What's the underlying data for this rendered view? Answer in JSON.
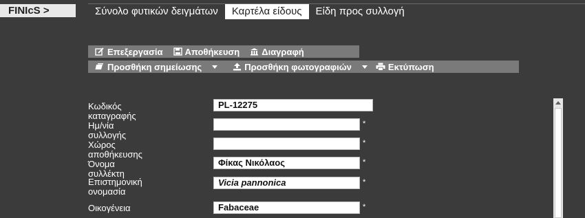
{
  "app": {
    "logo": "FINIcS >"
  },
  "tabs": [
    {
      "label": "Σύνολο φυτικών δειγμάτων",
      "active": false
    },
    {
      "label": "Καρτέλα είδους",
      "active": true
    },
    {
      "label": "Είδη προς συλλογή",
      "active": false
    }
  ],
  "toolbar1": {
    "edit": "Επεξεργασία",
    "save": "Αποθήκευση",
    "delete": "Διαγραφή"
  },
  "toolbar2": {
    "add_note": "Προσθήκη σημείωσης",
    "add_photos": "Προσθήκη φωτογραφιών",
    "print": "Εκτύπωση"
  },
  "form": {
    "fields": [
      {
        "label": "Κωδικός καταγραφής",
        "value": "PL-12275",
        "required": false
      },
      {
        "label": "Ημ/νία συλλογής",
        "value": "",
        "required": true
      },
      {
        "label": "Χώρος αποθήκευσης",
        "value": "",
        "required": true
      },
      {
        "label": "Όνομα συλλέκτη",
        "value": "Φίκας Νικόλαος",
        "required": true
      },
      {
        "label_line1": "Επιστημονική",
        "label_line2": "ονομασία",
        "value": "Vicia pannonica",
        "required": true
      },
      {
        "label": "Οικογένεια",
        "value": "Fabaceae",
        "required": true
      }
    ],
    "required_mark": "*"
  },
  "colors": {
    "background": "#3b3b3b",
    "toolbar": "#7a7a7a",
    "active_tab": "#ffffff"
  }
}
